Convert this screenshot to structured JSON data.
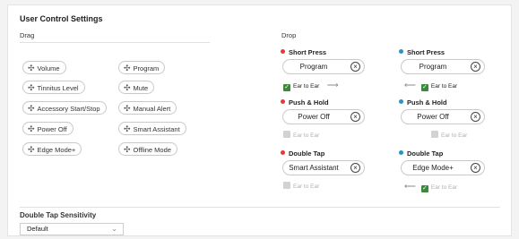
{
  "title": "User Control Settings",
  "drag": {
    "heading": "Drag",
    "chips_left": [
      "Volume",
      "Tinnitus Level",
      "Accessory Start/Stop",
      "Power Off",
      "Edge Mode+"
    ],
    "chips_right": [
      "Program",
      "Mute",
      "Manual Alert",
      "Smart Assistant",
      "Offline Mode"
    ]
  },
  "drop": {
    "heading": "Drop",
    "colors": {
      "left": "#e53935",
      "right": "#2196c9"
    },
    "rows": [
      {
        "left": {
          "label": "Short Press",
          "value": "Program",
          "checkbox_label": "Ear to Ear",
          "checked": true,
          "enabled": true,
          "arrow": "⟶"
        },
        "right": {
          "label": "Short Press",
          "value": "Program",
          "checkbox_label": "Ear to Ear",
          "checked": true,
          "enabled": true,
          "arrow": "⟵"
        }
      },
      {
        "left": {
          "label": "Push & Hold",
          "value": "Power Off",
          "checkbox_label": "Ear to Ear",
          "checked": false,
          "enabled": false
        },
        "right": {
          "label": "Push & Hold",
          "value": "Power Off",
          "checkbox_label": "Ear to Ear",
          "checked": false,
          "enabled": false
        }
      },
      {
        "left": {
          "label": "Double Tap",
          "value": "Smart Assistant",
          "checkbox_label": "Ear to Ear",
          "checked": false,
          "enabled": false
        },
        "right": {
          "label": "Double Tap",
          "value": "Edge Mode+",
          "checkbox_label": "Ear to Ear",
          "checked": true,
          "enabled": false,
          "arrow": "⟵"
        }
      }
    ]
  },
  "sensitivity": {
    "heading": "Double Tap Sensitivity",
    "value": "Default"
  },
  "icons": {
    "move": "move-icon",
    "clear": "clear-icon",
    "chevron": "chevron-down-icon"
  }
}
